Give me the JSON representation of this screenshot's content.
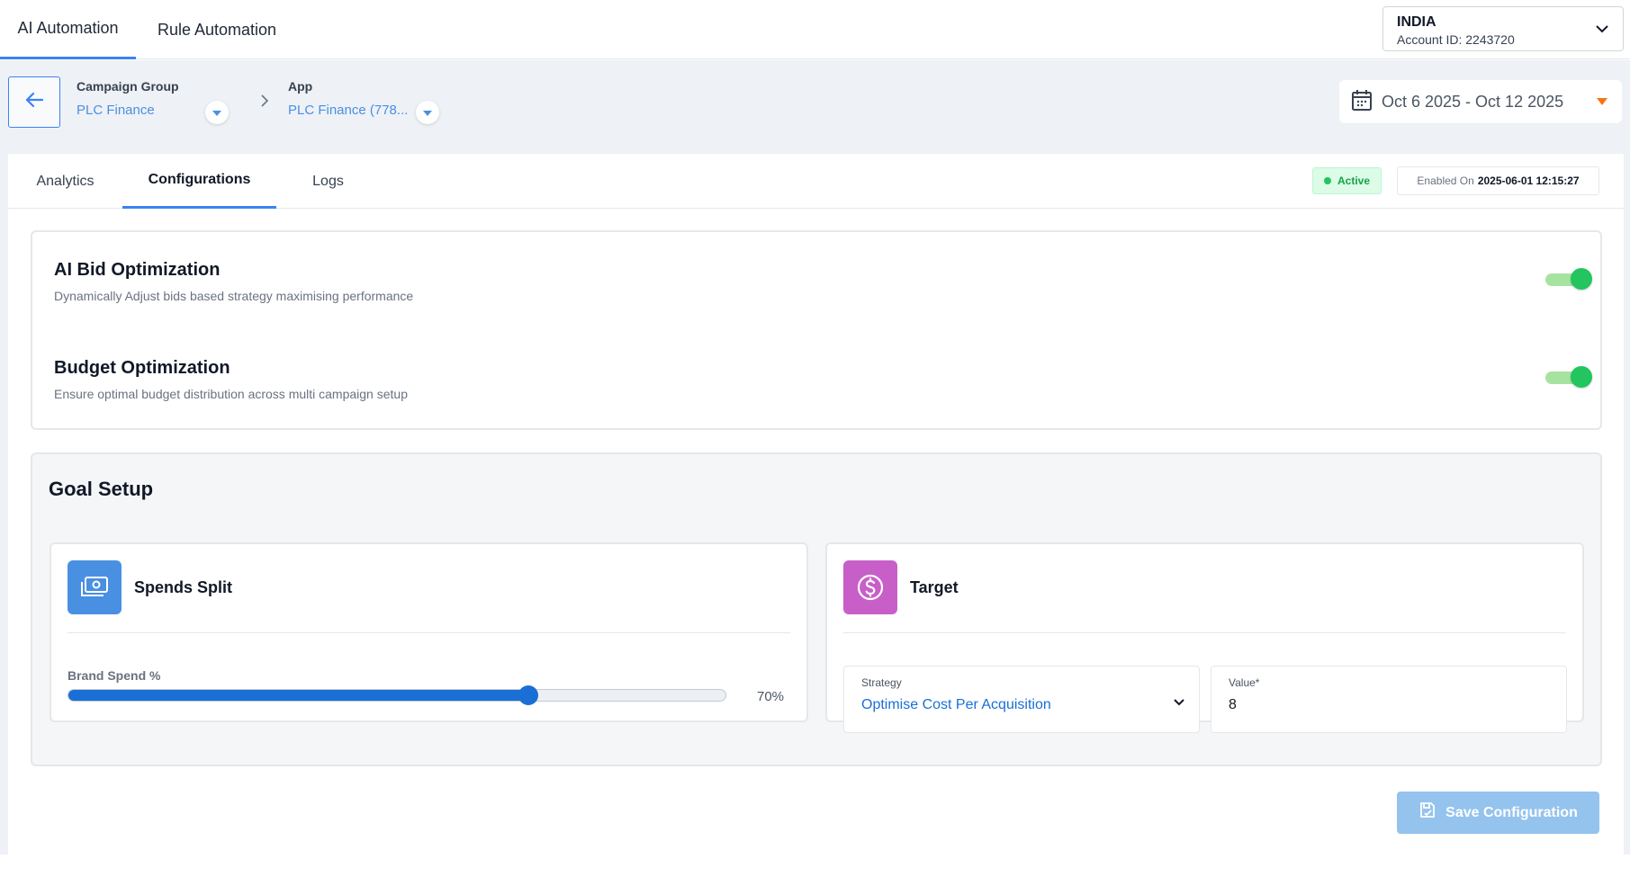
{
  "top_tabs": [
    {
      "label": "AI Automation"
    },
    {
      "label": "Rule Automation"
    }
  ],
  "account": {
    "name": "INDIA",
    "id_text": "Account ID: 2243720"
  },
  "breadcrumb": {
    "campaign_group": {
      "label": "Campaign Group",
      "value": "PLC Finance"
    },
    "app": {
      "label": "App",
      "value": "PLC Finance (778..."
    }
  },
  "date_range": "Oct 6 2025 - Oct 12 2025",
  "sub_tabs": [
    {
      "label": "Analytics"
    },
    {
      "label": "Configurations"
    },
    {
      "label": "Logs"
    }
  ],
  "status": {
    "label": "Active",
    "enabled_prefix": "Enabled On",
    "enabled_value": "2025-06-01 12:15:27"
  },
  "optimizations": [
    {
      "title": "AI Bid Optimization",
      "description": "Dynamically Adjust bids based strategy maximising performance",
      "enabled": true
    },
    {
      "title": "Budget Optimization",
      "description": "Ensure optimal budget distribution across multi campaign setup",
      "enabled": true
    }
  ],
  "goal_setup": {
    "title": "Goal Setup",
    "spends_split": {
      "heading": "Spends Split",
      "slider_label": "Brand Spend %",
      "percent": 70,
      "value_text": "70%"
    },
    "target": {
      "heading": "Target",
      "strategy_label": "Strategy",
      "strategy_value": "Optimise Cost Per Acquisition",
      "value_label": "Value*",
      "value": "8"
    }
  },
  "save_label": "Save Configuration",
  "colors": {
    "accent": "#3b82f6",
    "toggle_on": "#22c55e",
    "spend_icon": "#4a90e2",
    "target_icon": "#c85fc9"
  }
}
